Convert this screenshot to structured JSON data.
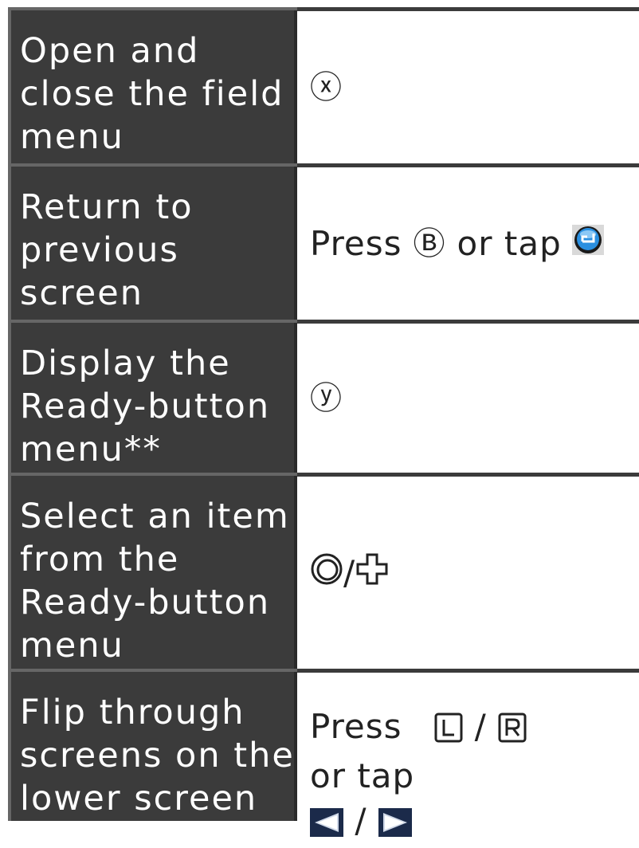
{
  "rows": [
    {
      "label": "Open and\nclose the field\nmenu",
      "value": {
        "button_glyph": "ⓧ"
      }
    },
    {
      "label": "Return to\nprevious\nscreen",
      "value": {
        "prefix": "Press",
        "button_glyph": "Ⓑ",
        "middle": "or tap",
        "icon": "back-button-icon",
        "icon_color": "#2a8fe0"
      }
    },
    {
      "label": "Display the\nReady-button\nmenu**",
      "value": {
        "button_glyph": "ⓨ"
      }
    },
    {
      "label": "Select an item\nfrom the\nReady-button\nmenu",
      "value": {
        "icons": [
          "circle-pad-icon",
          "dpad-icon"
        ],
        "separator": "/"
      }
    },
    {
      "label": "Flip through\nscreens on the\nlower screen",
      "value": {
        "prefix": "Press",
        "separator": "/",
        "suffix": "or tap",
        "buttons": [
          "L-button-icon",
          "R-button-icon"
        ],
        "arrows": [
          "left-arrow-icon",
          "right-arrow-icon"
        ],
        "arrow_bg": "#1b2a4a"
      }
    }
  ],
  "colors": {
    "label_bg": "#3b3b3b",
    "divider": "#666666",
    "label_text": "#ffffff",
    "value_text": "#222222"
  }
}
